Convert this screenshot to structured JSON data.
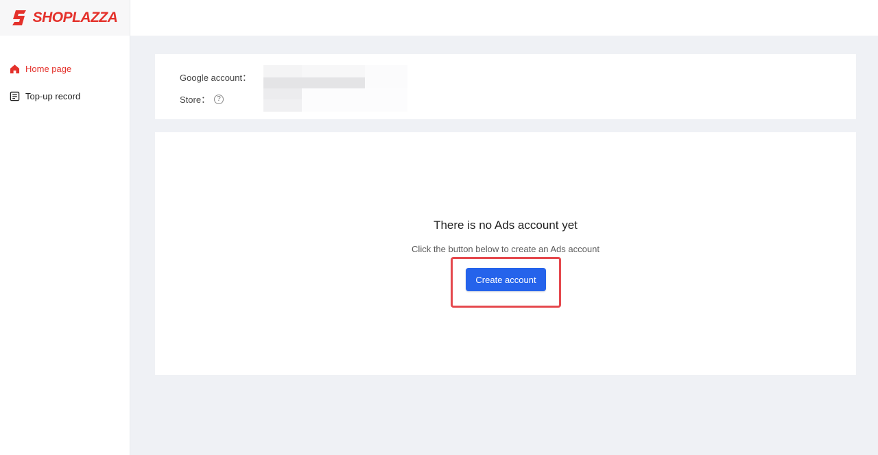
{
  "brand": {
    "name": "SHOPLAZZA",
    "color": "#e4312b"
  },
  "sidebar": {
    "items": [
      {
        "label": "Home page",
        "icon": "home-icon",
        "active": true
      },
      {
        "label": "Top-up record",
        "icon": "record-icon",
        "active": false
      }
    ]
  },
  "account": {
    "google_label": "Google account：",
    "store_label": "Store：",
    "store_help_icon": "help-circle-icon"
  },
  "empty_state": {
    "title": "There is no Ads account yet",
    "subtitle": "Click the button below to create an Ads account",
    "button_label": "Create account"
  },
  "colors": {
    "accent": "#e4312b",
    "primary_button": "#2563eb",
    "highlight": "#e5484d",
    "background": "#eff1f5"
  }
}
